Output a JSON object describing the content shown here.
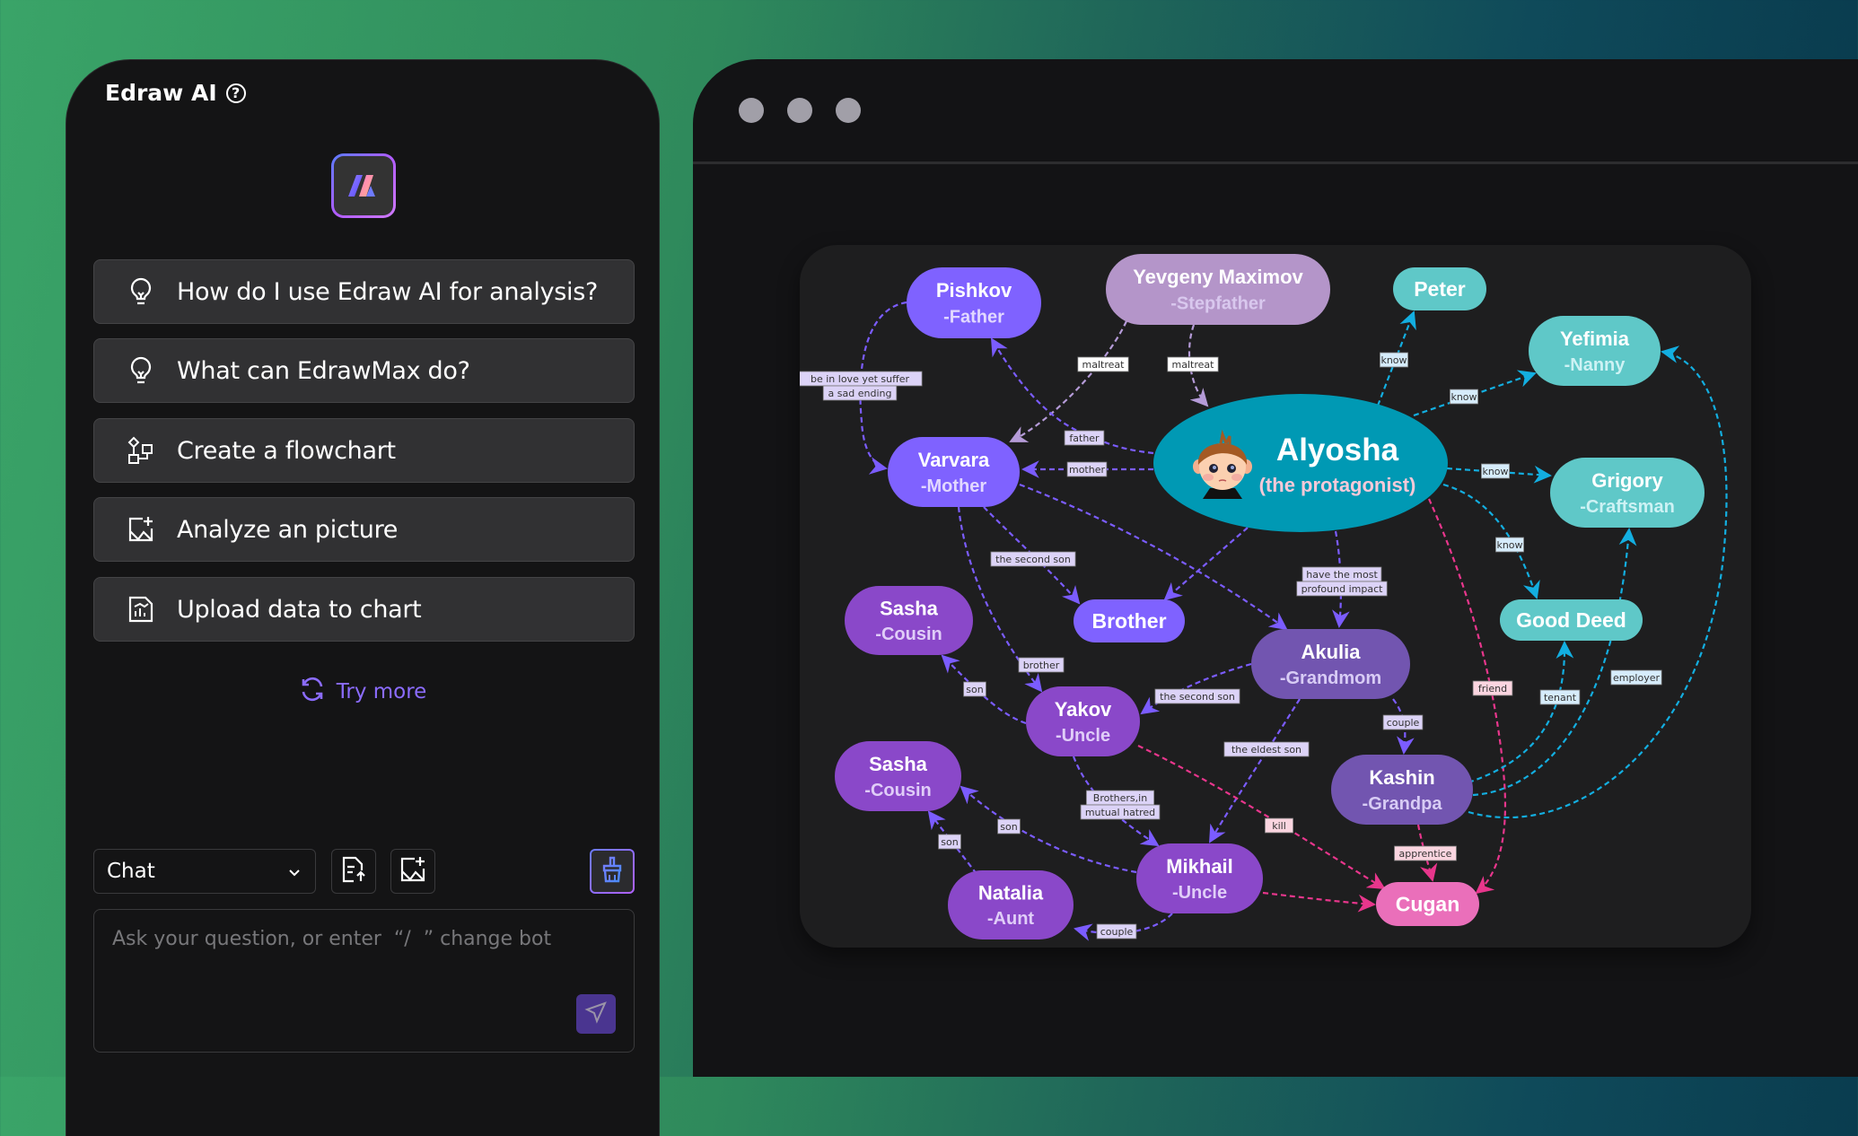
{
  "colors": {
    "accent": "#8b6cff",
    "purple_edge": "#7b5cff",
    "blue_edge": "#13aee0",
    "pink_edge": "#e8368c",
    "lilac_edge": "#b59bd8"
  },
  "panel": {
    "title": "Edraw AI",
    "help_icon": "question-circle-icon",
    "logo_icon": "edraw-ai-logo",
    "suggestions": [
      {
        "label": "How do I use Edraw AI for analysis?",
        "icon": "lightbulb-icon"
      },
      {
        "label": "What can EdrawMax do?",
        "icon": "lightbulb-icon"
      },
      {
        "label": "Create a flowchart",
        "icon": "flowchart-icon"
      },
      {
        "label": "Analyze an picture",
        "icon": "image-add-icon"
      },
      {
        "label": "Upload data to chart",
        "icon": "chart-file-icon"
      }
    ],
    "try_more": "Try more",
    "mode_select": {
      "value": "Chat"
    },
    "input": {
      "placeholder": "Ask your question, or enter  “/  ” change bot",
      "value": ""
    }
  },
  "window": {
    "controls": [
      "close",
      "minimize",
      "maximize"
    ]
  },
  "diagram": {
    "center": {
      "id": "alyosha",
      "title": "Alyosha",
      "subtitle": "(the protagonist)"
    },
    "nodes": [
      {
        "id": "pishkov",
        "title": "Pishkov",
        "subtitle": "-Father",
        "kind": "violet"
      },
      {
        "id": "yevgeny",
        "title": "Yevgeny Maximov",
        "subtitle": "-Stepfather",
        "kind": "lilac"
      },
      {
        "id": "peter",
        "title": "Peter",
        "subtitle": "",
        "kind": "teal"
      },
      {
        "id": "yefimia",
        "title": "Yefimia",
        "subtitle": "-Nanny",
        "kind": "teal"
      },
      {
        "id": "grigory",
        "title": "Grigory",
        "subtitle": "-Craftsman",
        "kind": "teal"
      },
      {
        "id": "gooddeed",
        "title": "Good Deed",
        "subtitle": "",
        "kind": "teal"
      },
      {
        "id": "varvara",
        "title": "Varvara",
        "subtitle": "-Mother",
        "kind": "violet"
      },
      {
        "id": "brother",
        "title": "Brother",
        "subtitle": "",
        "kind": "violet"
      },
      {
        "id": "akulia",
        "title": "Akulia",
        "subtitle": "-Grandmom",
        "kind": "grape"
      },
      {
        "id": "sasha1",
        "title": "Sasha",
        "subtitle": "-Cousin",
        "kind": "orchid"
      },
      {
        "id": "yakov",
        "title": "Yakov",
        "subtitle": "-Uncle",
        "kind": "orchid"
      },
      {
        "id": "sasha2",
        "title": "Sasha",
        "subtitle": "-Cousin",
        "kind": "orchid"
      },
      {
        "id": "kashin",
        "title": "Kashin",
        "subtitle": "-Grandpa",
        "kind": "grape"
      },
      {
        "id": "mikhail",
        "title": "Mikhail",
        "subtitle": "-Uncle",
        "kind": "orchid"
      },
      {
        "id": "natalia",
        "title": "Natalia",
        "subtitle": "-Aunt",
        "kind": "orchid"
      },
      {
        "id": "cugan",
        "title": "Cugan",
        "subtitle": "",
        "kind": "pink"
      }
    ],
    "edges": [
      {
        "from": "pishkov",
        "to": "varvara",
        "label": [
          "be in love yet suffer",
          "a sad ending"
        ],
        "color": "purple"
      },
      {
        "from": "yevgeny",
        "to": "varvara",
        "label": [
          "maltreat"
        ],
        "color": "lilac"
      },
      {
        "from": "yevgeny",
        "to": "alyosha",
        "label": [
          "maltreat"
        ],
        "color": "lilac"
      },
      {
        "from": "alyosha",
        "to": "pishkov",
        "label": [
          "father"
        ],
        "color": "purple"
      },
      {
        "from": "alyosha",
        "to": "varvara",
        "label": [
          "mother"
        ],
        "color": "purple"
      },
      {
        "from": "alyosha",
        "to": "peter",
        "label": [
          "know"
        ],
        "color": "blue"
      },
      {
        "from": "alyosha",
        "to": "yefimia",
        "label": [
          "know"
        ],
        "color": "blue"
      },
      {
        "from": "alyosha",
        "to": "grigory",
        "label": [
          "know"
        ],
        "color": "blue"
      },
      {
        "from": "alyosha",
        "to": "gooddeed",
        "label": [
          "know"
        ],
        "color": "blue"
      },
      {
        "from": "alyosha",
        "to": "brother",
        "label": [],
        "color": "purple"
      },
      {
        "from": "alyosha",
        "to": "akulia",
        "label": [
          "have the most",
          "profound impact"
        ],
        "color": "purple"
      },
      {
        "from": "alyosha",
        "to": "cugan",
        "label": [
          "friend"
        ],
        "color": "pink"
      },
      {
        "from": "varvara",
        "to": "brother",
        "label": [
          "the second son"
        ],
        "color": "purple"
      },
      {
        "from": "varvara",
        "to": "akulia",
        "label": [],
        "color": "purple"
      },
      {
        "from": "varvara",
        "to": "yakov",
        "label": [
          "brother"
        ],
        "color": "purple"
      },
      {
        "from": "akulia",
        "to": "yakov",
        "label": [
          "the second son"
        ],
        "color": "purple"
      },
      {
        "from": "akulia",
        "to": "mikhail",
        "label": [
          "the eldest son"
        ],
        "color": "purple"
      },
      {
        "from": "akulia",
        "to": "kashin",
        "label": [
          "couple"
        ],
        "color": "purple"
      },
      {
        "from": "yakov",
        "to": "sasha1",
        "label": [
          "son"
        ],
        "color": "purple"
      },
      {
        "from": "yakov",
        "to": "mikhail",
        "label": [
          "Brothers,in",
          "mutual hatred"
        ],
        "color": "purple"
      },
      {
        "from": "yakov",
        "to": "cugan",
        "label": [
          "kill"
        ],
        "color": "pink"
      },
      {
        "from": "mikhail",
        "to": "sasha2",
        "label": [
          "son"
        ],
        "color": "purple"
      },
      {
        "from": "mikhail",
        "to": "natalia",
        "label": [
          "couple"
        ],
        "color": "purple"
      },
      {
        "from": "mikhail",
        "to": "cugan",
        "label": [],
        "color": "pink"
      },
      {
        "from": "natalia",
        "to": "sasha2",
        "label": [
          "son"
        ],
        "color": "purple"
      },
      {
        "from": "kashin",
        "to": "gooddeed",
        "label": [
          "tenant"
        ],
        "color": "blue"
      },
      {
        "from": "kashin",
        "to": "grigory",
        "label": [
          "employer"
        ],
        "color": "blue"
      },
      {
        "from": "kashin",
        "to": "yefimia",
        "label": [],
        "color": "blue"
      },
      {
        "from": "kashin",
        "to": "cugan",
        "label": [
          "apprentice"
        ],
        "color": "pink"
      }
    ]
  }
}
